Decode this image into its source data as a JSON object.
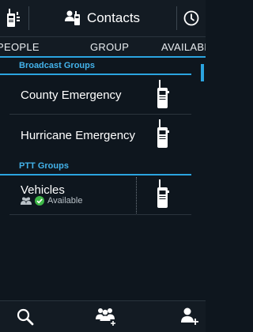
{
  "header": {
    "title": "Contacts",
    "left_icon": "radio-icon",
    "right_icon": "history-clock-icon"
  },
  "tabs": [
    {
      "label": "PEOPLE",
      "selected": false
    },
    {
      "label": "GROUP",
      "selected": true
    },
    {
      "label": "AVAILABLE",
      "selected": false
    }
  ],
  "sections": {
    "broadcast": {
      "title": "Broadcast Groups",
      "items": [
        {
          "name": "County Emergency",
          "icon": "radio-icon"
        },
        {
          "name": "Hurricane Emergency",
          "icon": "radio-icon"
        }
      ]
    },
    "ptt": {
      "title": "PTT Groups",
      "items": [
        {
          "name": "Vehicles",
          "status": "Available",
          "icon": "radio-icon"
        }
      ]
    }
  },
  "bottom_bar": {
    "icons": [
      "search-icon",
      "add-group-icon",
      "add-contact-icon"
    ]
  },
  "colors": {
    "accent": "#2ba4e0",
    "background": "#0e161e",
    "available_green": "#3fb848"
  }
}
